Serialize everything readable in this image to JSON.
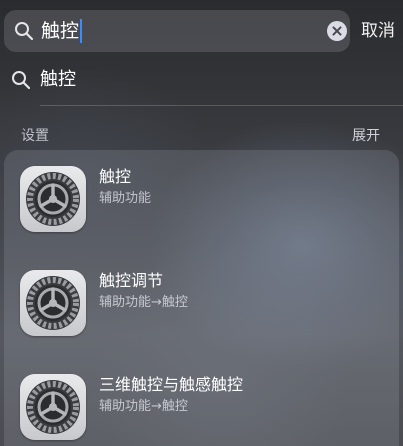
{
  "search": {
    "query": "触控",
    "cancel_label": "取消"
  },
  "suggestion": {
    "label": "触控"
  },
  "section": {
    "title": "设置",
    "expand_label": "展开"
  },
  "results": [
    {
      "icon": "settings-gear-icon",
      "title": "触控",
      "subtitle": "辅助功能"
    },
    {
      "icon": "settings-gear-icon",
      "title": "触控调节",
      "subtitle": "辅助功能→触控"
    },
    {
      "icon": "settings-gear-icon",
      "title": "三维触控与触感触控",
      "subtitle": "辅助功能→触控"
    }
  ],
  "colors": {
    "caret": "#3b8cff",
    "text": "#ffffff"
  }
}
